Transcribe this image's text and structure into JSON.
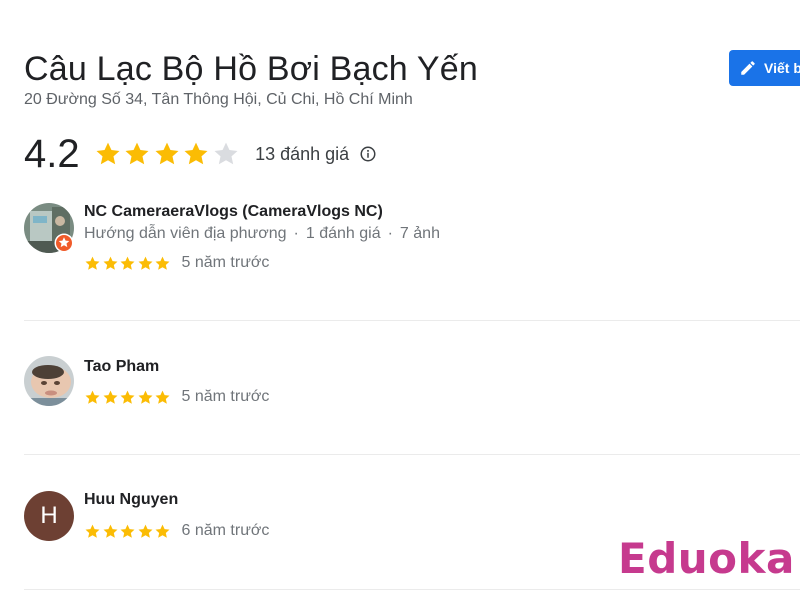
{
  "place": {
    "title": "Câu Lạc Bộ Hồ Bơi Bạch Yến",
    "address": "20 Đường Số 34, Tân Thông Hội, Củ Chi, Hồ Chí Minh",
    "rating": "4.2",
    "rating_value": 4.2,
    "review_count": "13 đánh giá",
    "info_icon": "info-icon"
  },
  "actions": {
    "write_review_label": "Viết b",
    "write_review_icon": "pencil-icon"
  },
  "colors": {
    "star": "#fbbc04",
    "star_empty": "#dadce0",
    "primary": "#1a73e8",
    "watermark": "#c63a8e"
  },
  "reviews": [
    {
      "name": "NC CameraeraVlogs (CameraVlogs NC)",
      "meta_role": "Hướng dẫn viên địa phương",
      "meta_reviews": "1 đánh giá",
      "meta_photos": "7 ảnh",
      "stars": 5,
      "date": "5 năm trước",
      "local_guide_badge": "local-guide-icon"
    },
    {
      "name": "Tao Pham",
      "stars": 5,
      "date": "5 năm trước"
    },
    {
      "name": "Huu Nguyen",
      "avatar_letter": "H",
      "stars": 5,
      "date": "6 năm trước"
    }
  ],
  "watermark": {
    "text": "Eduoka"
  }
}
